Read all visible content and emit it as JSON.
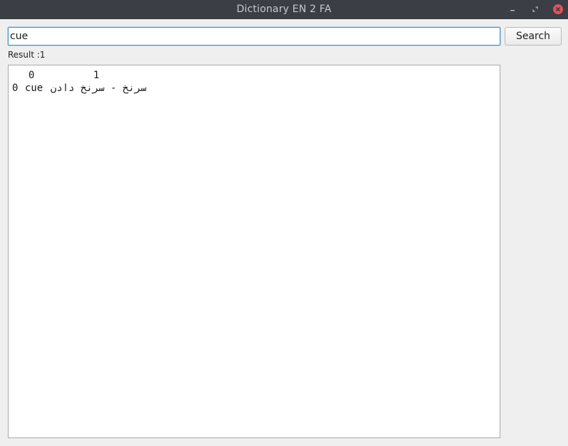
{
  "window": {
    "title": "Dictionary EN 2 FA",
    "controls": {
      "minimize_icon": "minimize-icon",
      "maximize_icon": "maximize-icon",
      "close_icon": "close-icon",
      "close_color": "#e0525a"
    },
    "titlebar_color": "#3b3e45"
  },
  "search": {
    "value": "cue",
    "button_label": "Search",
    "focus_color": "#3d8fd0"
  },
  "result": {
    "label": "Result :1"
  },
  "table": {
    "headers": [
      "0",
      "1"
    ],
    "rows": [
      {
        "index": "0",
        "word": "cue",
        "meaning": "سرنخ - سرنخ دادن"
      }
    ]
  }
}
